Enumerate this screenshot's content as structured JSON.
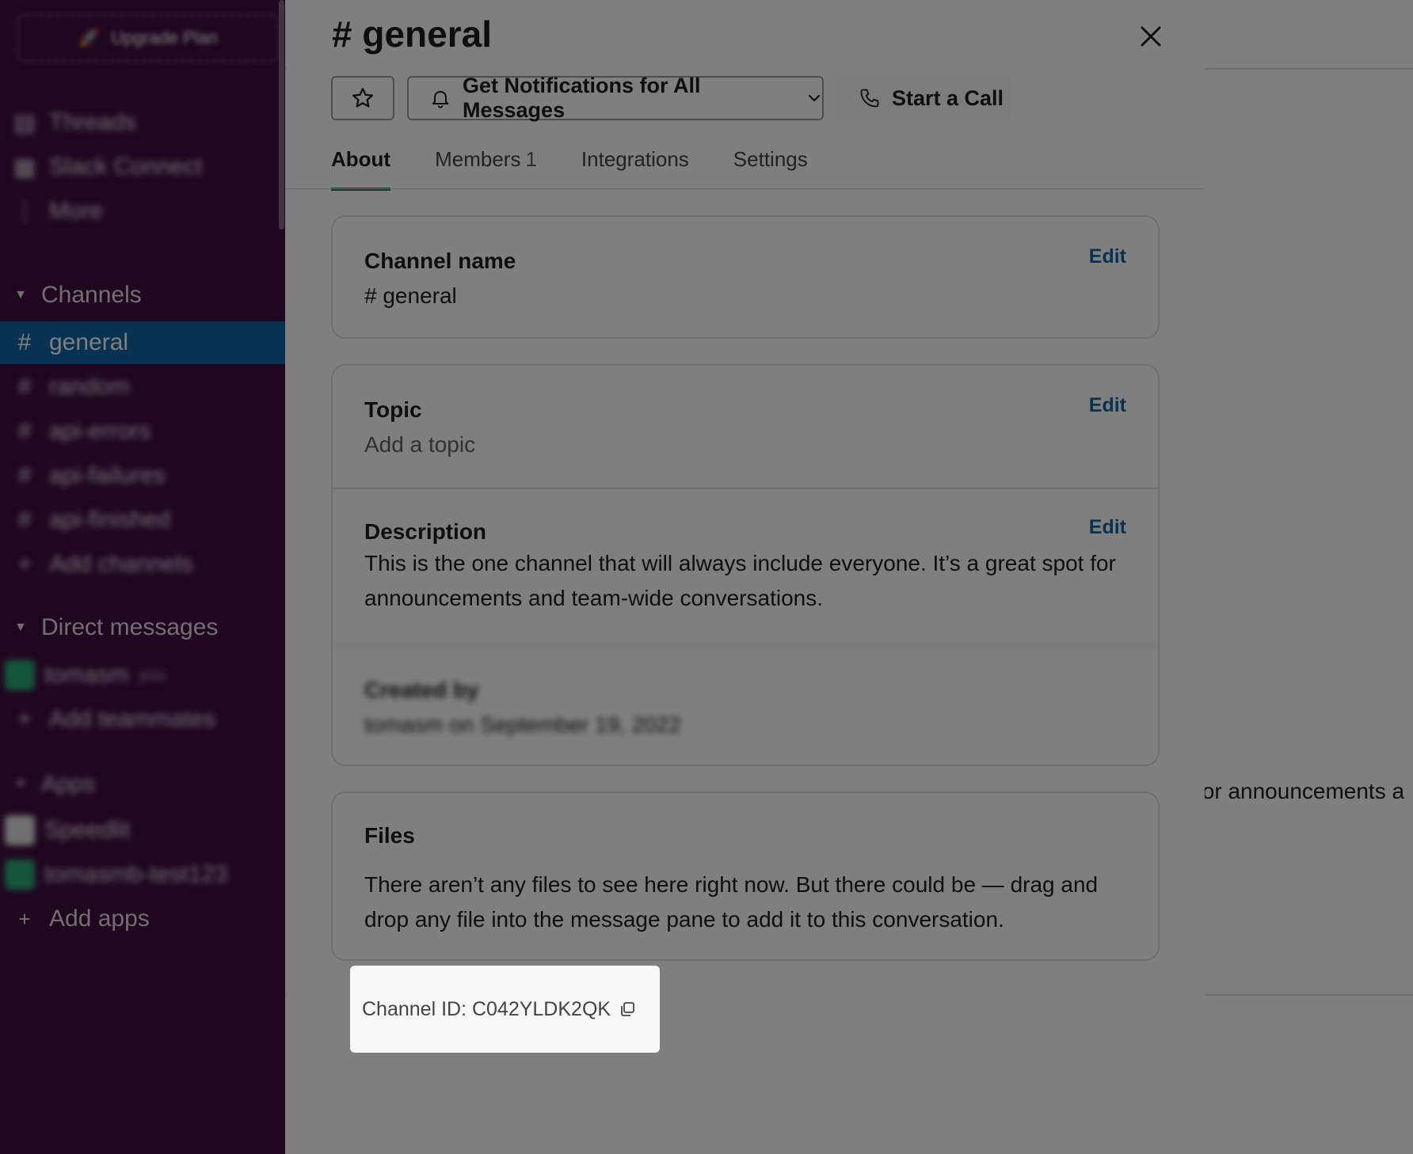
{
  "sidebar": {
    "upgrade_label": "Upgrade Plan",
    "nav_items": [
      {
        "label": "Threads",
        "icon": "threads-icon"
      },
      {
        "label": "Slack Connect",
        "icon": "connect-icon"
      },
      {
        "label": "More",
        "icon": "more-icon"
      }
    ],
    "channels_header": "Channels",
    "channels": [
      {
        "label": "general",
        "active": true
      },
      {
        "label": "random",
        "active": false
      },
      {
        "label": "api-errors",
        "active": false
      },
      {
        "label": "api-failures",
        "active": false
      },
      {
        "label": "api-finished",
        "active": false
      }
    ],
    "add_channels": "Add channels",
    "dm_header": "Direct messages",
    "dms": [
      {
        "label": "tomasm",
        "suffix": "you"
      }
    ],
    "add_teammates": "Add teammates",
    "apps_header": "Apps",
    "apps": [
      {
        "label": "Speedlit"
      },
      {
        "label": "tomasmb-test123"
      }
    ],
    "add_apps": "Add apps"
  },
  "background": {
    "snippet": "for announcements a"
  },
  "modal": {
    "title": "# general",
    "notify_label": "Get Notifications for All Messages",
    "call_label": "Start a Call",
    "tabs": [
      {
        "label": "About",
        "count": ""
      },
      {
        "label": "Members",
        "count": "1"
      },
      {
        "label": "Integrations",
        "count": ""
      },
      {
        "label": "Settings",
        "count": ""
      }
    ],
    "channel_name_label": "Channel name",
    "channel_name_value": "# general",
    "topic_label": "Topic",
    "topic_value": "Add a topic",
    "description_label": "Description",
    "description_value": "This is the one channel that will always include everyone. It’s a great spot for announcements and team-wide conversations.",
    "created_label": "Created by",
    "created_value": "tomasm on September 19, 2022",
    "edit_label": "Edit",
    "files_label": "Files",
    "files_text": "There aren’t any files to see here right now. But there could be — drag and drop any file into the message pane to add it to this conversation.",
    "channel_id_text": "Channel ID: C042YLDK2QK"
  },
  "colors": {
    "sidebar_bg": "#3f0e40",
    "active_channel": "#1164a3",
    "link": "#1264a3",
    "tab_underline": "#007a5a"
  }
}
